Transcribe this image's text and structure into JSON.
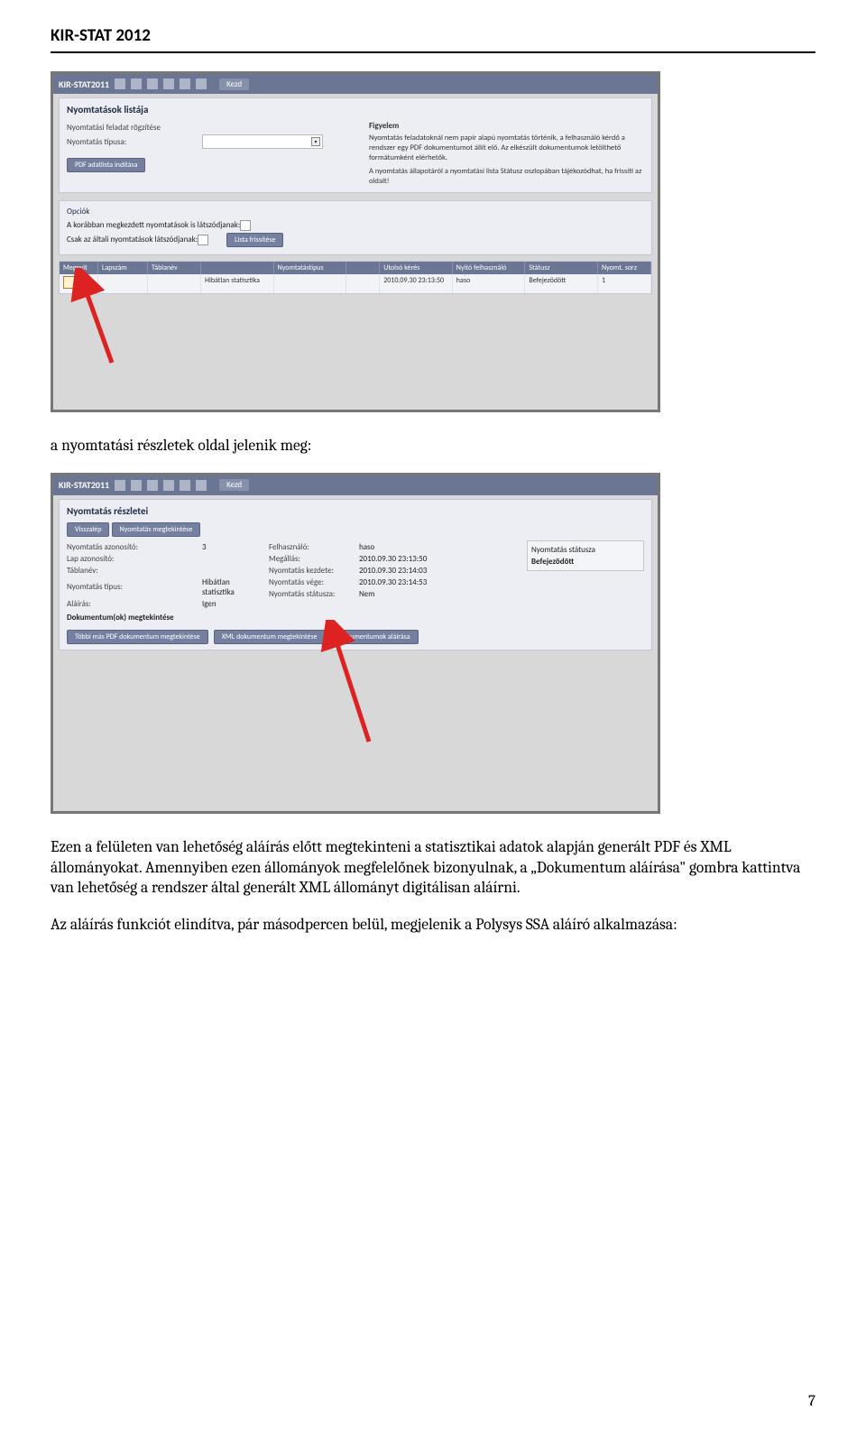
{
  "doc_header": "KIR-STAT 2012",
  "page_number": "7",
  "shot1": {
    "app_title": "KIR-STAT2011",
    "toolbar_extra": "Kezd",
    "panel_title": "Nyomtatások listája",
    "left": {
      "row1_label": "Nyomtatási feladat rögzítése",
      "row2_label": "Nyomtatás típusa:",
      "btn_pdf": "PDF adatlista indítása",
      "figyelem_heading": "Figyelem",
      "figyelem_text": "Nyomtatás feladatoknál nem papír alapú nyomtatás történik, a felhasználó kérdő a rendszer egy PDF dokumentumot állít elő. Az elkészült dokumentumok letölthető formátumként elérhetők.",
      "figyelem_text2": "A nyomtatás állapotáról a nyomtatási lista Státusz oszlopában tájékozódhat, ha frissíti az oldalt!"
    },
    "opc": {
      "heading": "Opciók",
      "row1": "A korábban megkezdett nyomtatások is látszódjanak: ",
      "row2": "Csak az általi nyomtatások látszódjanak: ",
      "btn_refresh": "Lista frissítése"
    },
    "table_headers": [
      "Megnyit",
      "Lapszám",
      "Táblanév",
      "",
      "Nyomtatástípus",
      "",
      "Utolsó kérés",
      "Nyitó felhasználó",
      "Státusz",
      "Nyomt. sorz"
    ],
    "table_row": {
      "c0": "",
      "c1": "",
      "c2": "",
      "c3": "Hibátlan statisztika",
      "c4": "",
      "c5": "",
      "c6": "2010.09.30 23:13:50",
      "c7": "haso",
      "c8": "Befejezödött",
      "c9": "1"
    }
  },
  "narrative1": "a nyomtatási részletek oldal jelenik meg:",
  "shot2": {
    "app_title": "KIR-STAT2011",
    "toolbar_extra": "Kezd",
    "panel_title": "Nyomtatás részletei",
    "btn_back": "Visszalép",
    "btn_view": "Nyomtatás megtekintése",
    "labels": {
      "azon": "Nyomtatás azonosító:",
      "azon_v": "3",
      "lap": "Lap azonosító:",
      "lap_v": "",
      "tabla": "Táblanév:",
      "tabla_v": "",
      "tipus": "Nyomtatás típus:",
      "tipus_v": "Hibátlan statisztika",
      "alairas": "Aláírás:",
      "alairas_v": "Igen",
      "dok": "Dokumentum(ok) megtekintése"
    },
    "labels2": {
      "felh": "Felhasználó:",
      "felh_v": "haso",
      "megall": "Megállás:",
      "megall_v": "2010.09.30 23:13:50",
      "kezd": "Nyomtatás kezdete:",
      "kezd_v": "2010.09.30 23:14:03",
      "veg": "Nyomtatás vége:",
      "veg_v": "2010.09.30 23:14:53",
      "stat": "Nyomtatás státusza:",
      "stat_v": "Nem"
    },
    "right": {
      "vissza": "Nyomtatás státusza",
      "stat": "Befejezödött"
    },
    "btns": [
      "Többi más PDF dokumentum megtekintése",
      "XML dokumentum megtekintése",
      "Dokumentumok aláírása"
    ]
  },
  "narrative2": "Ezen a felületen van lehetőség aláírás előtt megtekinteni a statisztikai adatok alapján generált PDF és XML állományokat. Amennyiben ezen állományok megfelelőnek bizonyulnak, a „Dokumentum aláírása\" gombra kattintva van lehetőség a rendszer által generált XML állományt digitálisan aláírni.",
  "narrative3": "Az aláírás funkciót elindítva, pár másodpercen belül, megjelenik a Polysys SSA aláíró alkalmazása:"
}
